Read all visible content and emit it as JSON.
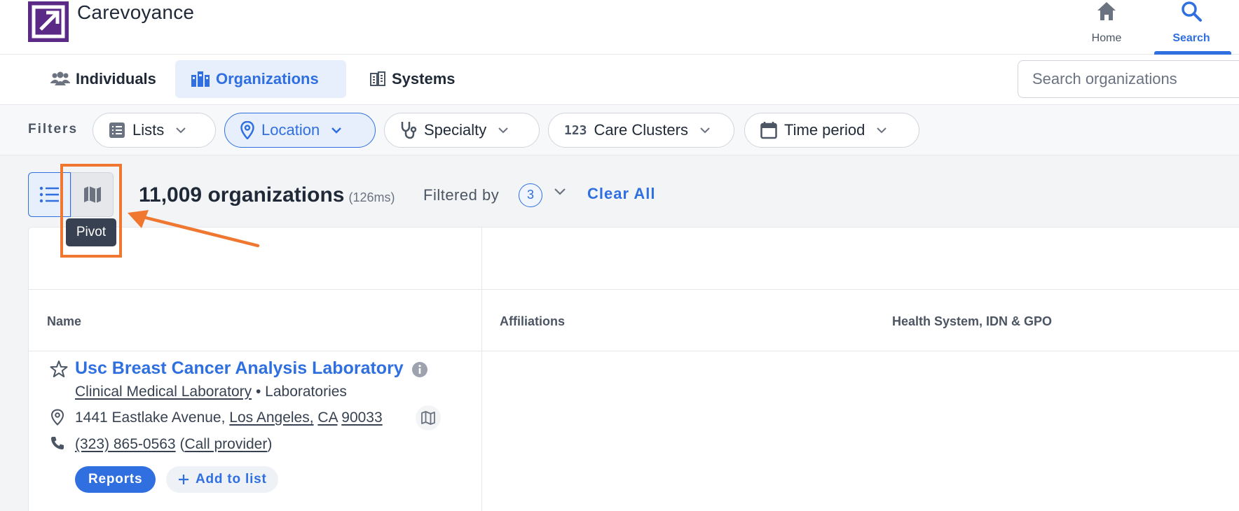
{
  "header": {
    "brand": "Carevoyance",
    "nav": [
      {
        "label": "Home",
        "icon": "home-icon"
      },
      {
        "label": "Search",
        "icon": "search-icon"
      }
    ]
  },
  "tabs": [
    {
      "label": "Individuals",
      "icon": "people-icon"
    },
    {
      "label": "Organizations",
      "icon": "buildings-icon",
      "active": true
    },
    {
      "label": "Systems",
      "icon": "systems-icon"
    }
  ],
  "search": {
    "placeholder": "Search organizations"
  },
  "filters": {
    "label": "Filters",
    "chips": [
      {
        "label": "Lists",
        "icon": "list-icon"
      },
      {
        "label": "Location",
        "icon": "location-pin-icon",
        "active": true
      },
      {
        "label": "Specialty",
        "icon": "stethoscope-icon"
      },
      {
        "label": "Care Clusters",
        "icon": "numbers-icon"
      },
      {
        "label": "Time period",
        "icon": "calendar-icon"
      }
    ]
  },
  "results": {
    "count_text": "11,009 organizations",
    "timing": "(126ms)",
    "filtered_by_label": "Filtered by",
    "filter_count": "3",
    "clear_all": "Clear All"
  },
  "tooltip": {
    "text": "Pivot"
  },
  "table": {
    "columns": [
      "Name",
      "Affiliations",
      "Health System, IDN & GPO"
    ],
    "rows": [
      {
        "name": "Usc Breast Cancer Analysis Laboratory",
        "type_link": "Clinical Medical Laboratory",
        "separator": "•",
        "category": "Laboratories",
        "address_street": "1441 Eastlake Avenue,",
        "address_city": "Los Angeles,",
        "address_state": "CA",
        "address_zip": "90033",
        "phone": "(323) 865-0563",
        "call_link": "Call provider",
        "reports_label": "Reports",
        "add_label": "Add to list"
      }
    ]
  },
  "colors": {
    "accent": "#2f6fe0",
    "brand_purple": "#5b2a86",
    "annotation_orange": "#f0772f",
    "tooltip_bg": "#374151"
  }
}
